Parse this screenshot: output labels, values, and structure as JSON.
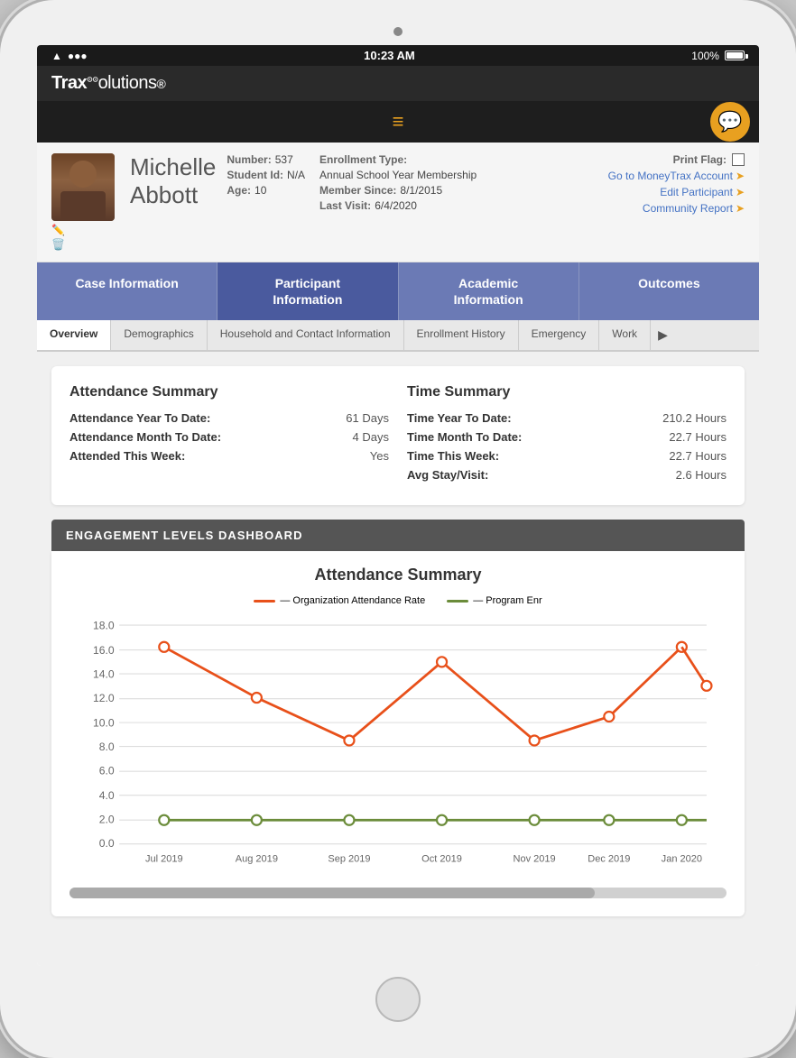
{
  "device": {
    "status_bar": {
      "wifi": "WiFi",
      "time": "10:23 AM",
      "battery_percent": "100%"
    }
  },
  "app": {
    "logo": "TraxSolutions",
    "nav": {
      "hamburger": "≡",
      "chat": "💬"
    }
  },
  "profile": {
    "name_line1": "Michelle",
    "name_line2": "Abbott",
    "number_label": "Number:",
    "number_value": "537",
    "student_id_label": "Student Id:",
    "student_id_value": "N/A",
    "age_label": "Age:",
    "age_value": "10",
    "enrollment_type_label": "Enrollment Type:",
    "enrollment_type_value": "Annual School Year Membership",
    "member_since_label": "Member Since:",
    "member_since_value": "8/1/2015",
    "last_visit_label": "Last Visit:",
    "last_visit_value": "6/4/2020",
    "print_flag_label": "Print Flag:",
    "link1": "Go to MoneyTrax Account",
    "link2": "Edit Participant",
    "link3": "Community Report"
  },
  "main_tabs": [
    {
      "label": "Case Information",
      "active": false
    },
    {
      "label": "Participant Information",
      "active": true
    },
    {
      "label": "Academic Information",
      "active": false
    },
    {
      "label": "Outcomes",
      "active": false
    }
  ],
  "sub_tabs": [
    {
      "label": "Overview",
      "active": true
    },
    {
      "label": "Demographics",
      "active": false
    },
    {
      "label": "Household and Contact Information",
      "active": false
    },
    {
      "label": "Enrollment History",
      "active": false
    },
    {
      "label": "Emergency",
      "active": false
    },
    {
      "label": "Work",
      "active": false
    }
  ],
  "attendance_summary": {
    "title": "Attendance Summary",
    "rows": [
      {
        "label": "Attendance Year To Date:",
        "value": "61 Days"
      },
      {
        "label": "Attendance Month To Date:",
        "value": "4 Days"
      },
      {
        "label": "Attended This Week:",
        "value": "Yes"
      }
    ]
  },
  "time_summary": {
    "title": "Time Summary",
    "rows": [
      {
        "label": "Time Year To Date:",
        "value": "210.2 Hours"
      },
      {
        "label": "Time Month To Date:",
        "value": "22.7 Hours"
      },
      {
        "label": "Time This Week:",
        "value": "22.7 Hours"
      },
      {
        "label": "Avg Stay/Visit:",
        "value": "2.6 Hours"
      }
    ]
  },
  "dashboard": {
    "header": "ENGAGEMENT LEVELS DASHBOARD",
    "chart_title": "Attendance Summary",
    "legend": [
      {
        "label": "Organization Attendance Rate",
        "color": "orange"
      },
      {
        "label": "Program Enr",
        "color": "green"
      }
    ],
    "chart": {
      "months": [
        "Jul 2019",
        "Aug 2019",
        "Sep 2019",
        "Oct 2019",
        "Nov 2019",
        "Dec 2019",
        "Jan 2020"
      ],
      "y_labels": [
        "0.0",
        "2.0",
        "4.0",
        "6.0",
        "8.0",
        "10.0",
        "12.0",
        "14.0",
        "16.0",
        "18.0"
      ],
      "org_data": [
        16.2,
        12.0,
        8.5,
        15.0,
        8.5,
        10.5,
        16.2,
        13.0
      ],
      "program_data": [
        2.0,
        2.0,
        2.0,
        2.0,
        2.0,
        2.0,
        2.0,
        2.0
      ]
    }
  }
}
